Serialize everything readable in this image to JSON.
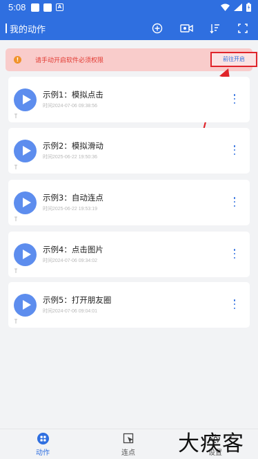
{
  "status_bar": {
    "time": "5:08",
    "mini_icon_label": "A"
  },
  "app_bar": {
    "title": "我的动作"
  },
  "alert": {
    "message": "请手动开启软件必须权限",
    "button_label": "前往开启"
  },
  "actions": [
    {
      "title": "示例1：模拟点击",
      "time": "时间2024-07-06 09:38:56"
    },
    {
      "title": "示例2：模拟滑动",
      "time": "时间2025-06-22 19:50:36"
    },
    {
      "title": "示例3：自动连点",
      "time": "时间2025-06-22 19:53:19"
    },
    {
      "title": "示例4：点击图片",
      "time": "时间2024-07-06 09:34:02"
    },
    {
      "title": "示例5：打开朋友圈",
      "time": "时间2024-07-06 09:04:01"
    }
  ],
  "bottom_nav": [
    {
      "label": "动作",
      "active": true
    },
    {
      "label": "连点",
      "active": false
    },
    {
      "label": "设置",
      "active": false
    }
  ],
  "watermark": {
    "text": "大疾客"
  },
  "colors": {
    "primary": "#2f6fe0",
    "alert_bg": "#f9cccb",
    "alert_text": "#e23b33",
    "highlight": "#e0242a",
    "play": "#5d8dee"
  }
}
